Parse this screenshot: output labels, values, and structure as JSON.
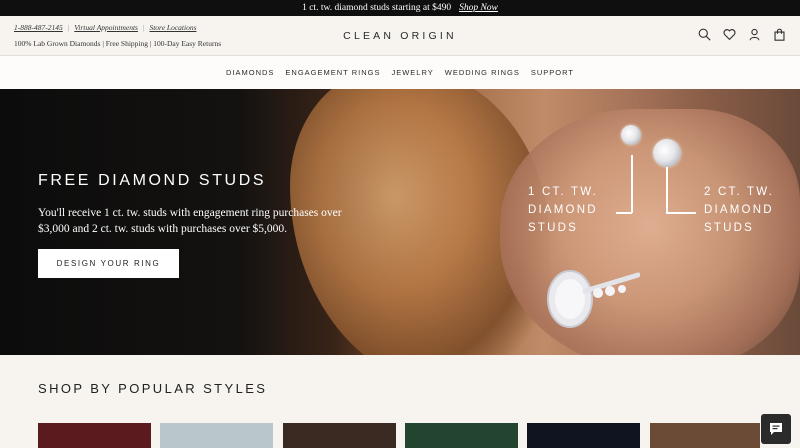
{
  "promo": {
    "text": "1 ct. tw. diamond studs starting at $490",
    "link": "Shop Now"
  },
  "header": {
    "phone": "1-888-487-2145",
    "virtual": "Virtual Appointments",
    "stores": "Store Locations",
    "tagline": "100% Lab Grown Diamonds | Free Shipping | 100-Day Easy Returns",
    "logo": "CLEAN ORIGIN",
    "icons": [
      "search-icon",
      "heart-icon",
      "user-icon",
      "bag-icon"
    ]
  },
  "nav": {
    "items": [
      "DIAMONDS",
      "ENGAGEMENT RINGS",
      "JEWELRY",
      "WEDDING RINGS",
      "SUPPORT"
    ]
  },
  "hero": {
    "title": "FREE DIAMOND STUDS",
    "body": "You'll receive 1 ct. tw. studs with engagement ring purchases over $3,000 and 2 ct. tw. studs with purchases over $5,000.",
    "button": "DESIGN YOUR RING",
    "callout1": {
      "line1": "1 CT. TW.",
      "line2": "DIAMOND",
      "line3": "STUDS"
    },
    "callout2": {
      "line1": "2 CT. TW.",
      "line2": "DIAMOND",
      "line3": "STUDS"
    }
  },
  "section": {
    "title": "SHOP BY POPULAR STYLES"
  },
  "tiles": [
    {
      "color": "#5a1a1e"
    },
    {
      "color": "#b9c7cc"
    },
    {
      "color": "#3a2a22"
    },
    {
      "color": "#23452f"
    },
    {
      "color": "#0f1420"
    },
    {
      "color": "#6b4a36"
    }
  ],
  "chat": {
    "icon": "chat-icon"
  }
}
